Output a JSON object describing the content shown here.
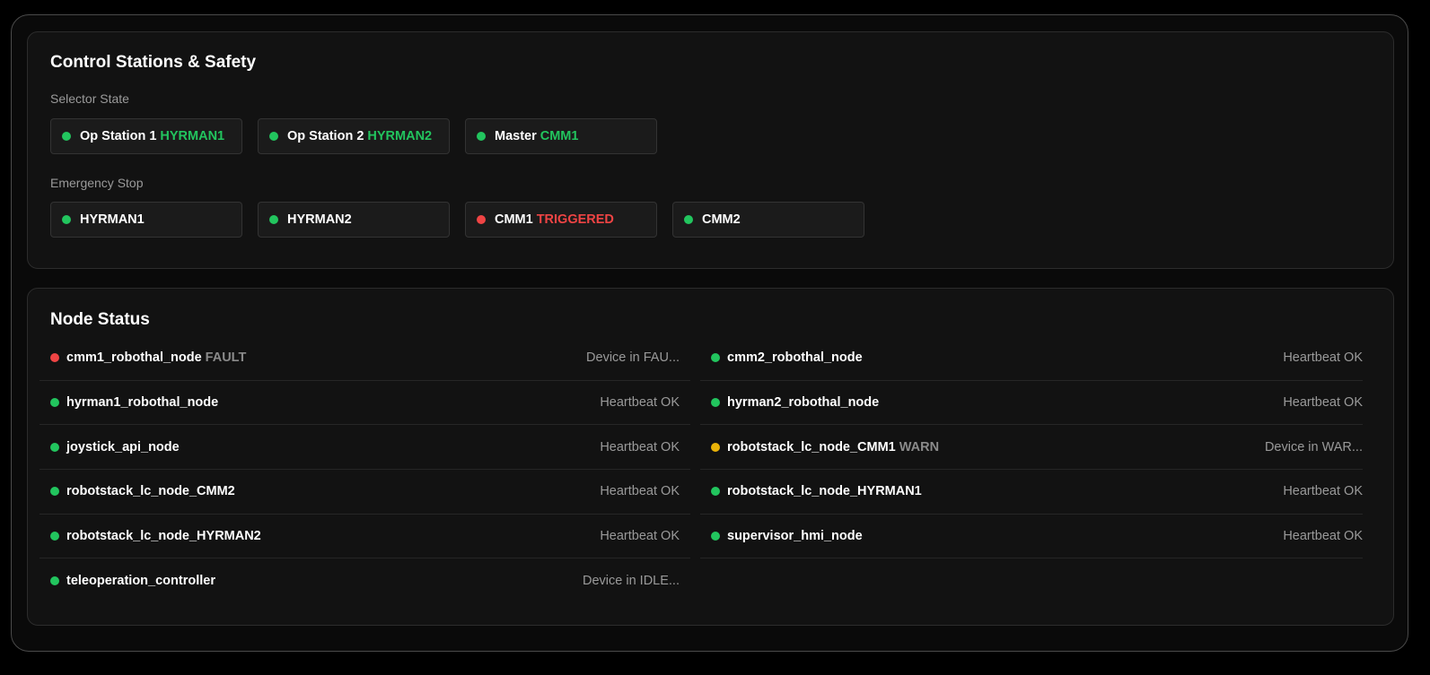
{
  "colors": {
    "ok": "#22c55e",
    "fault": "#ef4444",
    "warn": "#eab308"
  },
  "safety": {
    "title": "Control Stations & Safety",
    "selector_label": "Selector State",
    "selector": [
      {
        "label": "Op Station 1",
        "value": "HYRMAN1",
        "status": "ok"
      },
      {
        "label": "Op Station 2",
        "value": "HYRMAN2",
        "status": "ok"
      },
      {
        "label": "Master",
        "value": "CMM1",
        "status": "ok"
      }
    ],
    "estop_label": "Emergency Stop",
    "estop": [
      {
        "label": "HYRMAN1",
        "value": "",
        "status": "ok"
      },
      {
        "label": "HYRMAN2",
        "value": "",
        "status": "ok"
      },
      {
        "label": "CMM1",
        "value": "TRIGGERED",
        "status": "fault"
      },
      {
        "label": "CMM2",
        "value": "",
        "status": "ok"
      }
    ]
  },
  "nodes": {
    "title": "Node Status",
    "left": [
      {
        "name": "cmm1_robothal_node",
        "flag": "FAULT",
        "msg": "Device in FAU...",
        "status": "fault"
      },
      {
        "name": "hyrman1_robothal_node",
        "flag": "",
        "msg": "Heartbeat OK",
        "status": "ok"
      },
      {
        "name": "joystick_api_node",
        "flag": "",
        "msg": "Heartbeat OK",
        "status": "ok"
      },
      {
        "name": "robotstack_lc_node_CMM2",
        "flag": "",
        "msg": "Heartbeat OK",
        "status": "ok"
      },
      {
        "name": "robotstack_lc_node_HYRMAN2",
        "flag": "",
        "msg": "Heartbeat OK",
        "status": "ok"
      },
      {
        "name": "teleoperation_controller",
        "flag": "",
        "msg": "Device in IDLE...",
        "status": "ok"
      }
    ],
    "right": [
      {
        "name": "cmm2_robothal_node",
        "flag": "",
        "msg": "Heartbeat OK",
        "status": "ok"
      },
      {
        "name": "hyrman2_robothal_node",
        "flag": "",
        "msg": "Heartbeat OK",
        "status": "ok"
      },
      {
        "name": "robotstack_lc_node_CMM1",
        "flag": "WARN",
        "msg": "Device in WAR...",
        "status": "warn"
      },
      {
        "name": "robotstack_lc_node_HYRMAN1",
        "flag": "",
        "msg": "Heartbeat OK",
        "status": "ok"
      },
      {
        "name": "supervisor_hmi_node",
        "flag": "",
        "msg": "Heartbeat OK",
        "status": "ok"
      }
    ]
  }
}
